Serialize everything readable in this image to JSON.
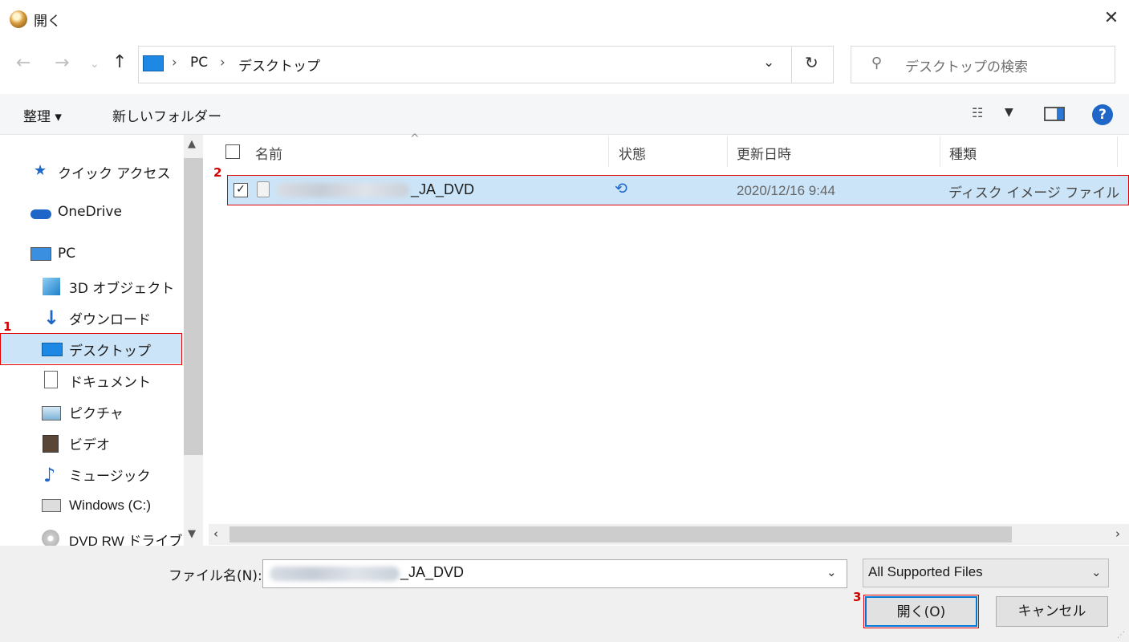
{
  "window": {
    "title": "開く",
    "close_glyph": "✕"
  },
  "address": {
    "crumbs": [
      "PC",
      "デスクトップ"
    ],
    "separator": "›"
  },
  "search": {
    "placeholder": "デスクトップの検索"
  },
  "toolbar": {
    "organize": "整理 ▾",
    "new_folder": "新しいフォルダー",
    "help": "?"
  },
  "nav": {
    "items": [
      {
        "label": "クイック アクセス",
        "icon": "star-icon"
      },
      {
        "label": "OneDrive",
        "icon": "cloud-icon"
      },
      {
        "label": "PC",
        "icon": "pc-icon"
      },
      {
        "label": "3D オブジェクト",
        "icon": "cube-icon"
      },
      {
        "label": "ダウンロード",
        "icon": "download-arrow-icon"
      },
      {
        "label": "デスクトップ",
        "icon": "desktop-icon",
        "selected": true
      },
      {
        "label": "ドキュメント",
        "icon": "document-icon"
      },
      {
        "label": "ピクチャ",
        "icon": "picture-icon"
      },
      {
        "label": "ビデオ",
        "icon": "video-icon"
      },
      {
        "label": "ミュージック",
        "icon": "music-note-icon"
      },
      {
        "label": "Windows (C:)",
        "icon": "drive-icon"
      },
      {
        "label": "DVD RW ドライブ (",
        "icon": "disc-icon"
      }
    ]
  },
  "columns": {
    "name": "名前",
    "status": "状態",
    "modified": "更新日時",
    "type": "種類"
  },
  "files": [
    {
      "name_suffix": "_JA_DVD",
      "modified": "2020/12/16 9:44",
      "type": "ディスク イメージ ファイル",
      "checked": true
    }
  ],
  "footer": {
    "filename_label": "ファイル名(N):",
    "filename_suffix": "_JA_DVD",
    "filter": "All Supported Files",
    "open": "開く(O)",
    "cancel": "キャンセル"
  },
  "annotations": [
    "1",
    "2",
    "3"
  ],
  "colors": {
    "accent": "#1e66c7",
    "highlight": "#cce4f7",
    "annotation": "#d00000"
  }
}
